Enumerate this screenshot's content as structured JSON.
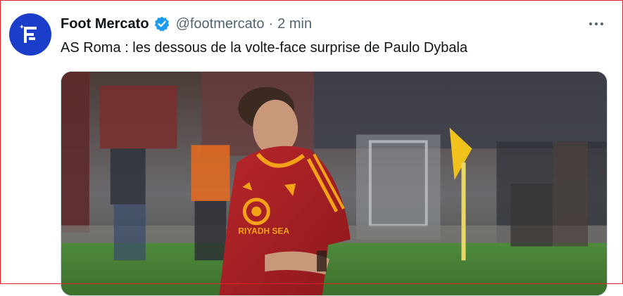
{
  "tweet": {
    "author_name": "Foot Mercato",
    "handle": "@footmercato",
    "separator": "·",
    "time": "2 min",
    "text": "AS Roma : les dessous de la volte-face surprise de Paulo Dybala",
    "media": {
      "sponsor_text": "RIYADH SEA"
    }
  },
  "icons": {
    "avatar": "foot-mercato-logo",
    "verified": "verified-badge-icon",
    "more": "more-options-icon"
  },
  "colors": {
    "avatar_bg": "#1a3ec9",
    "verified": "#1d9bf0",
    "jersey": "#a51f24",
    "jersey_trim": "#f4a218",
    "frame_border": "#e0242a"
  }
}
